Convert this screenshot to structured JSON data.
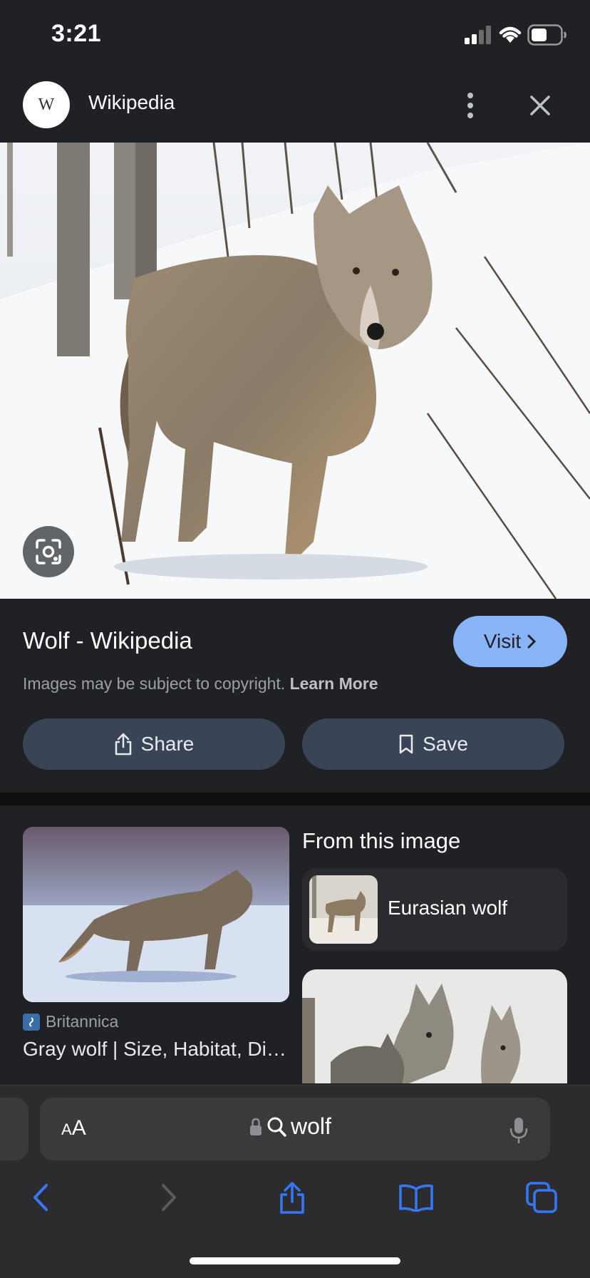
{
  "status_bar": {
    "time": "3:21",
    "icons": [
      "signal-icon",
      "wifi-icon",
      "battery-icon"
    ]
  },
  "header": {
    "site_name": "Wikipedia",
    "logo_letter": "W",
    "menu_icon": "more-vert-icon",
    "close_icon": "close-icon"
  },
  "main_image": {
    "subject": "gray wolf standing in snow",
    "lens_icon": "lens-icon"
  },
  "result": {
    "title": "Wolf - Wikipedia",
    "visit_label": "Visit",
    "copyright_text": "Images may be subject to copyright.",
    "learn_more": "Learn More",
    "share_label": "Share",
    "save_label": "Save"
  },
  "related": {
    "source": "Britannica",
    "title": "Gray wolf | Size, Habitat, Diet, & Facts | Britannica"
  },
  "from_image": {
    "heading": "From this image",
    "entity_label": "Eurasian wolf"
  },
  "browser": {
    "aa_label": "AA",
    "query": "wolf",
    "icons": [
      "lock-icon",
      "search-icon",
      "mic-icon",
      "back-icon",
      "forward-icon",
      "share-icon",
      "bookmarks-icon",
      "tabs-icon"
    ]
  },
  "colors": {
    "background": "#202124",
    "accent": "#8ab4f8",
    "pill": "#394457",
    "safari_blue": "#3478f6"
  }
}
